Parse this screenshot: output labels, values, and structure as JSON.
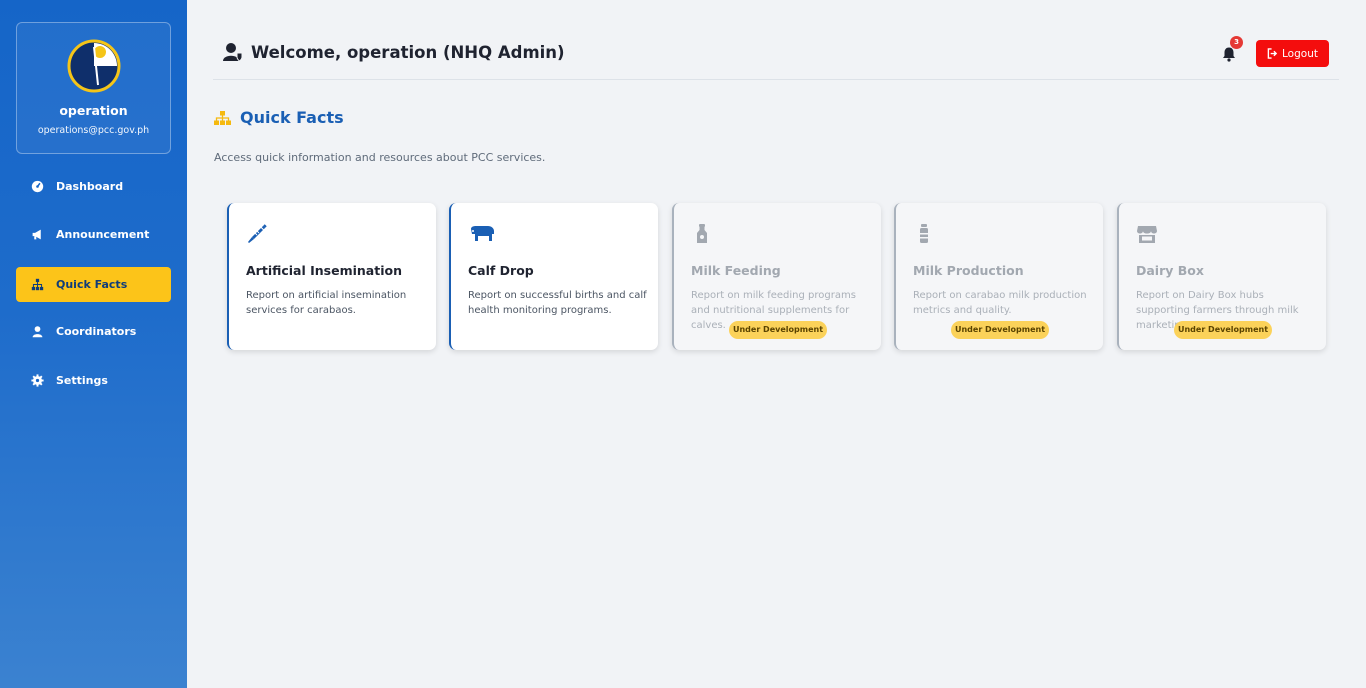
{
  "sidebar": {
    "profile": {
      "name": "operation",
      "email": "operations@pcc.gov.ph"
    },
    "items": [
      {
        "label": "Dashboard",
        "icon": "dashboard-icon",
        "active": false
      },
      {
        "label": "Announcement",
        "icon": "megaphone-icon",
        "active": false
      },
      {
        "label": "Quick Facts",
        "icon": "sitemap-icon",
        "active": true
      },
      {
        "label": "Coordinators",
        "icon": "user-icon",
        "active": false
      },
      {
        "label": "Settings",
        "icon": "gear-icon",
        "active": false
      }
    ]
  },
  "header": {
    "welcome": "Welcome, operation (NHQ Admin)",
    "notification_count": "3",
    "logout_label": "Logout"
  },
  "section": {
    "title": "Quick Facts",
    "description": "Access quick information and resources about PCC services."
  },
  "cards": [
    {
      "title": "Artificial Insemination",
      "description": "Report on artificial insemination services for carabaos.",
      "icon": "syringe-icon",
      "status": ""
    },
    {
      "title": "Calf Drop",
      "description": "Report on successful births and calf health monitoring programs.",
      "icon": "cow-icon",
      "status": ""
    },
    {
      "title": "Milk Feeding",
      "description": "Report on milk feeding programs and nutritional supplements for calves.",
      "icon": "bottle-icon",
      "status": "Under Development"
    },
    {
      "title": "Milk Production",
      "description": "Report on carabao milk production metrics and quality.",
      "icon": "milk-bottle-icon",
      "status": "Under Development"
    },
    {
      "title": "Dairy Box",
      "description": "Report on Dairy Box hubs supporting farmers through milk marketing.",
      "icon": "store-icon",
      "status": "Under Development"
    }
  ],
  "colors": {
    "primary": "#1a5fb4",
    "accent": "#fcc419",
    "danger": "#f40d0d",
    "badge": "#fbd25a"
  }
}
